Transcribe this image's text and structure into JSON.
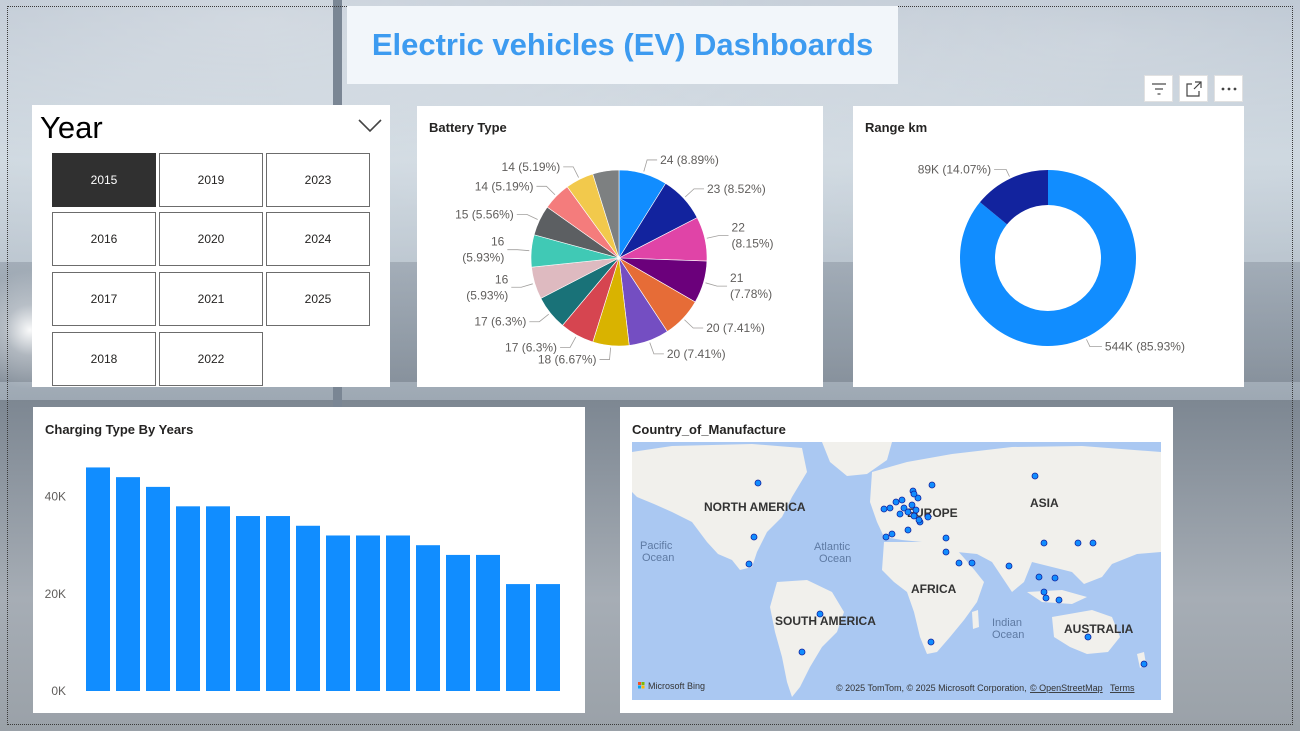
{
  "dashboard_title": "Electric vehicles (EV) Dashboards",
  "year_slicer": {
    "heading": "Year",
    "selected": "2015",
    "years": [
      "2015",
      "2016",
      "2017",
      "2018",
      "2019",
      "2020",
      "2021",
      "2022",
      "2023",
      "2024",
      "2025"
    ]
  },
  "toolbar": {
    "icons": [
      "filter-icon",
      "focus-mode-icon",
      "more-options-icon"
    ]
  },
  "colors": {
    "accent": "#118DFF",
    "title": "#3d9bf0",
    "selected_tile": "#303030"
  },
  "chart_data": [
    {
      "type": "pie",
      "title": "Battery Type",
      "values": [
        24,
        23,
        22,
        21,
        20,
        20,
        18,
        17,
        17,
        16,
        16,
        15,
        14,
        14,
        13
      ],
      "labels": [
        "24 (8.89%)",
        "23 (8.52%)",
        "22 (8.15%)",
        "21 (7.78%)",
        "20 (7.41%)",
        "20 (7.41%)",
        "18 (6.67%)",
        "17 (6.3%)",
        "17 (6.3%)",
        "16 (5.93%)",
        "16 (5.93%)",
        "15 (5.56%)",
        "14 (5.19%)",
        "14 (5.19%)",
        ""
      ],
      "colors": [
        "#118DFF",
        "#12239E",
        "#E044A7",
        "#6B007B",
        "#E66C37",
        "#744EC2",
        "#D9B300",
        "#D64550",
        "#197278",
        "#DEBAC0",
        "#40C9B5",
        "#5C5F62",
        "#F47C7C",
        "#F2C94C",
        "#7D8081"
      ]
    },
    {
      "type": "pie",
      "title": "Range km",
      "values": [
        544,
        89
      ],
      "labels": [
        "544K (85.93%)",
        "89K (14.07%)"
      ],
      "colors": [
        "#118DFF",
        "#12239E"
      ]
    },
    {
      "type": "bar",
      "title": "Charging Type By Years",
      "values": [
        46,
        44,
        42,
        38,
        38,
        36,
        36,
        34,
        32,
        32,
        32,
        30,
        28,
        28,
        22,
        22
      ],
      "y_ticks": [
        "0K",
        "20K",
        "40K"
      ],
      "ylim": [
        0,
        50
      ],
      "color": "#118DFF"
    }
  ],
  "map": {
    "title": "Country_of_Manufacture",
    "regions": [
      "NORTH AMERICA",
      "EUROPE",
      "ASIA",
      "AFRICA",
      "SOUTH AMERICA",
      "AUSTRALIA"
    ],
    "oceans": [
      "Pacific",
      "Ocean",
      "Atlantic",
      "Ocean",
      "Indian",
      "Ocean"
    ],
    "logo": "Microsoft Bing",
    "attribution": "© 2025 TomTom, © 2025 Microsoft Corporation,",
    "osm": "© OpenStreetMap",
    "terms": "Terms"
  }
}
